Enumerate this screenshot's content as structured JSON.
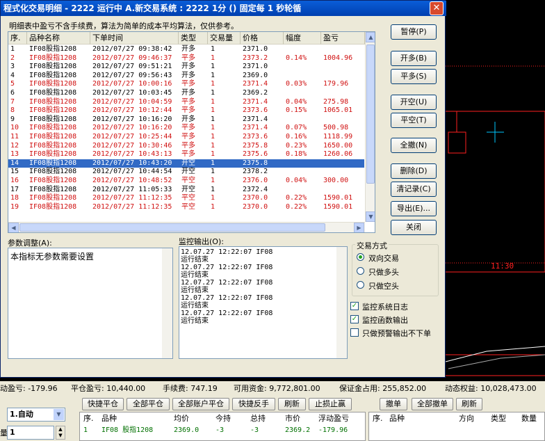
{
  "window": {
    "title": "程式化交易明细 - 2222 运行中  A.新交易系统 : 2222 1分 () 固定每 1 秒轮循",
    "close_glyph": "✕",
    "note": "明细表中盈亏不含手续费，算法为简单的成本平均算法，仅供参考。"
  },
  "table": {
    "headers": [
      "序.",
      "品种名称",
      "下单时间",
      "类型",
      "交易量",
      "价格",
      "幅度",
      "盈亏"
    ],
    "rows": [
      {
        "no": "1",
        "name": "IF08股指1208",
        "time": "2012/07/27 09:38:42",
        "type": "开多",
        "qty": "1",
        "price": "2371.0",
        "pct": "",
        "pnl": "",
        "color": "black",
        "selected": false
      },
      {
        "no": "2",
        "name": "IF08股指1208",
        "time": "2012/07/27 09:46:37",
        "type": "平多",
        "qty": "1",
        "price": "2373.2",
        "pct": "0.14%",
        "pnl": "1004.96",
        "color": "red",
        "selected": false
      },
      {
        "no": "3",
        "name": "IF08股指1208",
        "time": "2012/07/27 09:51:21",
        "type": "开多",
        "qty": "1",
        "price": "2371.0",
        "pct": "",
        "pnl": "",
        "color": "black",
        "selected": false
      },
      {
        "no": "4",
        "name": "IF08股指1208",
        "time": "2012/07/27 09:56:43",
        "type": "开多",
        "qty": "1",
        "price": "2369.0",
        "pct": "",
        "pnl": "",
        "color": "black",
        "selected": false
      },
      {
        "no": "5",
        "name": "IF08股指1208",
        "time": "2012/07/27 10:00:16",
        "type": "平多",
        "qty": "1",
        "price": "2371.4",
        "pct": "0.03%",
        "pnl": "179.96",
        "color": "red",
        "selected": false
      },
      {
        "no": "6",
        "name": "IF08股指1208",
        "time": "2012/07/27 10:03:45",
        "type": "开多",
        "qty": "1",
        "price": "2369.2",
        "pct": "",
        "pnl": "",
        "color": "black",
        "selected": false
      },
      {
        "no": "7",
        "name": "IF08股指1208",
        "time": "2012/07/27 10:04:59",
        "type": "平多",
        "qty": "1",
        "price": "2371.4",
        "pct": "0.04%",
        "pnl": "275.98",
        "color": "red",
        "selected": false
      },
      {
        "no": "8",
        "name": "IF08股指1208",
        "time": "2012/07/27 10:12:44",
        "type": "平多",
        "qty": "1",
        "price": "2373.6",
        "pct": "0.15%",
        "pnl": "1065.01",
        "color": "red",
        "selected": false
      },
      {
        "no": "9",
        "name": "IF08股指1208",
        "time": "2012/07/27 10:16:20",
        "type": "开多",
        "qty": "1",
        "price": "2371.4",
        "pct": "",
        "pnl": "",
        "color": "black",
        "selected": false
      },
      {
        "no": "10",
        "name": "IF08股指1208",
        "time": "2012/07/27 10:16:20",
        "type": "平多",
        "qty": "1",
        "price": "2371.4",
        "pct": "0.07%",
        "pnl": "500.98",
        "color": "red",
        "selected": false
      },
      {
        "no": "11",
        "name": "IF08股指1208",
        "time": "2012/07/27 10:25:44",
        "type": "平多",
        "qty": "1",
        "price": "2373.6",
        "pct": "0.16%",
        "pnl": "1118.99",
        "color": "red",
        "selected": false
      },
      {
        "no": "12",
        "name": "IF08股指1208",
        "time": "2012/07/27 10:30:46",
        "type": "平多",
        "qty": "1",
        "price": "2375.8",
        "pct": "0.23%",
        "pnl": "1650.00",
        "color": "red",
        "selected": false
      },
      {
        "no": "13",
        "name": "IF08股指1208",
        "time": "2012/07/27 10:43:13",
        "type": "平多",
        "qty": "1",
        "price": "2375.6",
        "pct": "0.18%",
        "pnl": "1260.06",
        "color": "red",
        "selected": false
      },
      {
        "no": "14",
        "name": "IF08股指1208",
        "time": "2012/07/27 10:43:20",
        "type": "开空",
        "qty": "1",
        "price": "2375.8",
        "pct": "",
        "pnl": "",
        "color": "black",
        "selected": true
      },
      {
        "no": "15",
        "name": "IF08股指1208",
        "time": "2012/07/27 10:44:54",
        "type": "开空",
        "qty": "1",
        "price": "2378.2",
        "pct": "",
        "pnl": "",
        "color": "black",
        "selected": false
      },
      {
        "no": "16",
        "name": "IF08股指1208",
        "time": "2012/07/27 10:48:52",
        "type": "平空",
        "qty": "1",
        "price": "2376.0",
        "pct": "0.04%",
        "pnl": "300.00",
        "color": "red",
        "selected": false
      },
      {
        "no": "17",
        "name": "IF08股指1208",
        "time": "2012/07/27 11:05:33",
        "type": "开空",
        "qty": "1",
        "price": "2372.4",
        "pct": "",
        "pnl": "",
        "color": "black",
        "selected": false
      },
      {
        "no": "18",
        "name": "IF08股指1208",
        "time": "2012/07/27 11:12:35",
        "type": "平空",
        "qty": "1",
        "price": "2370.0",
        "pct": "0.22%",
        "pnl": "1590.01",
        "color": "red",
        "selected": false
      },
      {
        "no": "19",
        "name": "IF08股指1208",
        "time": "2012/07/27 11:12:35",
        "type": "平空",
        "qty": "1",
        "price": "2370.0",
        "pct": "0.22%",
        "pnl": "1590.01",
        "color": "red",
        "selected": false
      }
    ]
  },
  "buttons": {
    "pause": "暂停(P)",
    "open_long": "开多(B)",
    "close_long": "平多(S)",
    "open_short": "开空(U)",
    "close_short": "平空(T)",
    "cancel_all": "全撤(N)",
    "delete": "删除(D)",
    "clear_log": "清记录(C)",
    "export": "导出(E)...",
    "close": "关闭"
  },
  "params": {
    "label": "参数调整(A):",
    "text": "本指标无参数需要设置"
  },
  "monitor": {
    "label": "监控输出(O):",
    "lines": [
      "12.07.27  12:22:07  IF08",
      "运行结束",
      "12.07.27  12:22:07  IF08",
      "运行结束",
      "12.07.27  12:22:07  IF08",
      "运行结束",
      "12.07.27  12:22:07  IF08",
      "运行结束",
      "12.07.27  12:22:07  IF08",
      "运行结束"
    ]
  },
  "trade_mode": {
    "label": "交易方式",
    "options": [
      "双向交易",
      "只做多头",
      "只做空头"
    ],
    "selected_index": 0
  },
  "checkboxes": [
    {
      "label": "监控系统日志",
      "checked": true
    },
    {
      "label": "监控函数输出",
      "checked": true
    },
    {
      "label": "只做预警输出不下单",
      "checked": false
    }
  ],
  "chart": {
    "time_label": "11:30",
    "red": "#ff2020",
    "cyan": "#00c8ff"
  },
  "status": {
    "items": [
      "动盈亏: -179.96",
      "平仓盈亏: 10,440.00",
      "手续费: 747.19",
      "可用资金: 9,772,801.00",
      "保证金占用: 255,852.00",
      "动态权益: 10,028,473.00"
    ]
  },
  "bottom": {
    "mode_select": "1.自动",
    "qty_value": "1",
    "qty_label": "量",
    "toolbar_left": [
      "快捷平仓",
      "全部平仓",
      "全部账户平仓",
      "快捷反手",
      "刷新",
      "止损止赢"
    ],
    "toolbar_right": [
      "撤单",
      "全部撤单",
      "刷新"
    ],
    "pos_headers": [
      "序.",
      "品种",
      "均价",
      "今持",
      "总持",
      "市价",
      "浮动盈亏"
    ],
    "pos_row": [
      "1",
      "IF08 股指1208",
      "2369.0",
      "-3",
      "-3",
      "2369.2",
      "-179.96"
    ],
    "order_headers": [
      "序.",
      "品种",
      "方向",
      "类型",
      "数量"
    ]
  }
}
